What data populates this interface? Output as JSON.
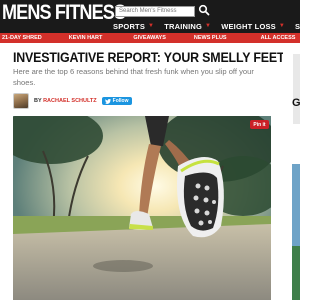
{
  "header": {
    "logo": "MENS FITNESS",
    "search_placeholder": "Search Men's Fitness",
    "nav": [
      {
        "label": "SPORTS"
      },
      {
        "label": "TRAINING"
      },
      {
        "label": "WEIGHT LOSS"
      },
      {
        "label": "STYLE"
      }
    ]
  },
  "subnav": {
    "items": [
      {
        "label": "21-DAY SHRED"
      },
      {
        "label": "KEVIN HART"
      },
      {
        "label": "GIVEAWAYS"
      },
      {
        "label": "NEWS PLUS"
      },
      {
        "label": "ALL ACCESS"
      }
    ]
  },
  "article": {
    "title": "INVESTIGATIVE REPORT: YOUR SMELLY FEET",
    "subtitle": "Here are the top 6 reasons behind that fresh funk when you slip off your shoes.",
    "byline_prefix": "BY",
    "author": "RACHAEL SCHULTZ",
    "follow_label": "Follow",
    "pin_label": "Pin it"
  },
  "colors": {
    "header_bg": "#1a1a1a",
    "accent_red": "#d3302a",
    "twitter_blue": "#1b95e0"
  }
}
